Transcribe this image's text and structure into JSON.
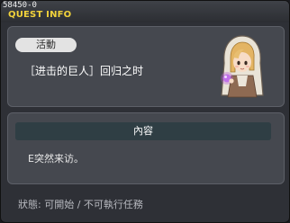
{
  "window": {
    "quest_id": "58450-0",
    "title": "QUEST INFO"
  },
  "quest": {
    "tag": "活動",
    "name": "［进击的巨人］回归之时",
    "npc_icon": "npc-girl-with-purple-orb"
  },
  "content": {
    "header": "內容",
    "text": "E突然来访。"
  },
  "status": {
    "text": "狀態: 可開始 / 不可執行任務"
  },
  "colors": {
    "title_yellow": "#f1d23b",
    "panel": "#45484f",
    "header_bar": "#2f3e44"
  }
}
